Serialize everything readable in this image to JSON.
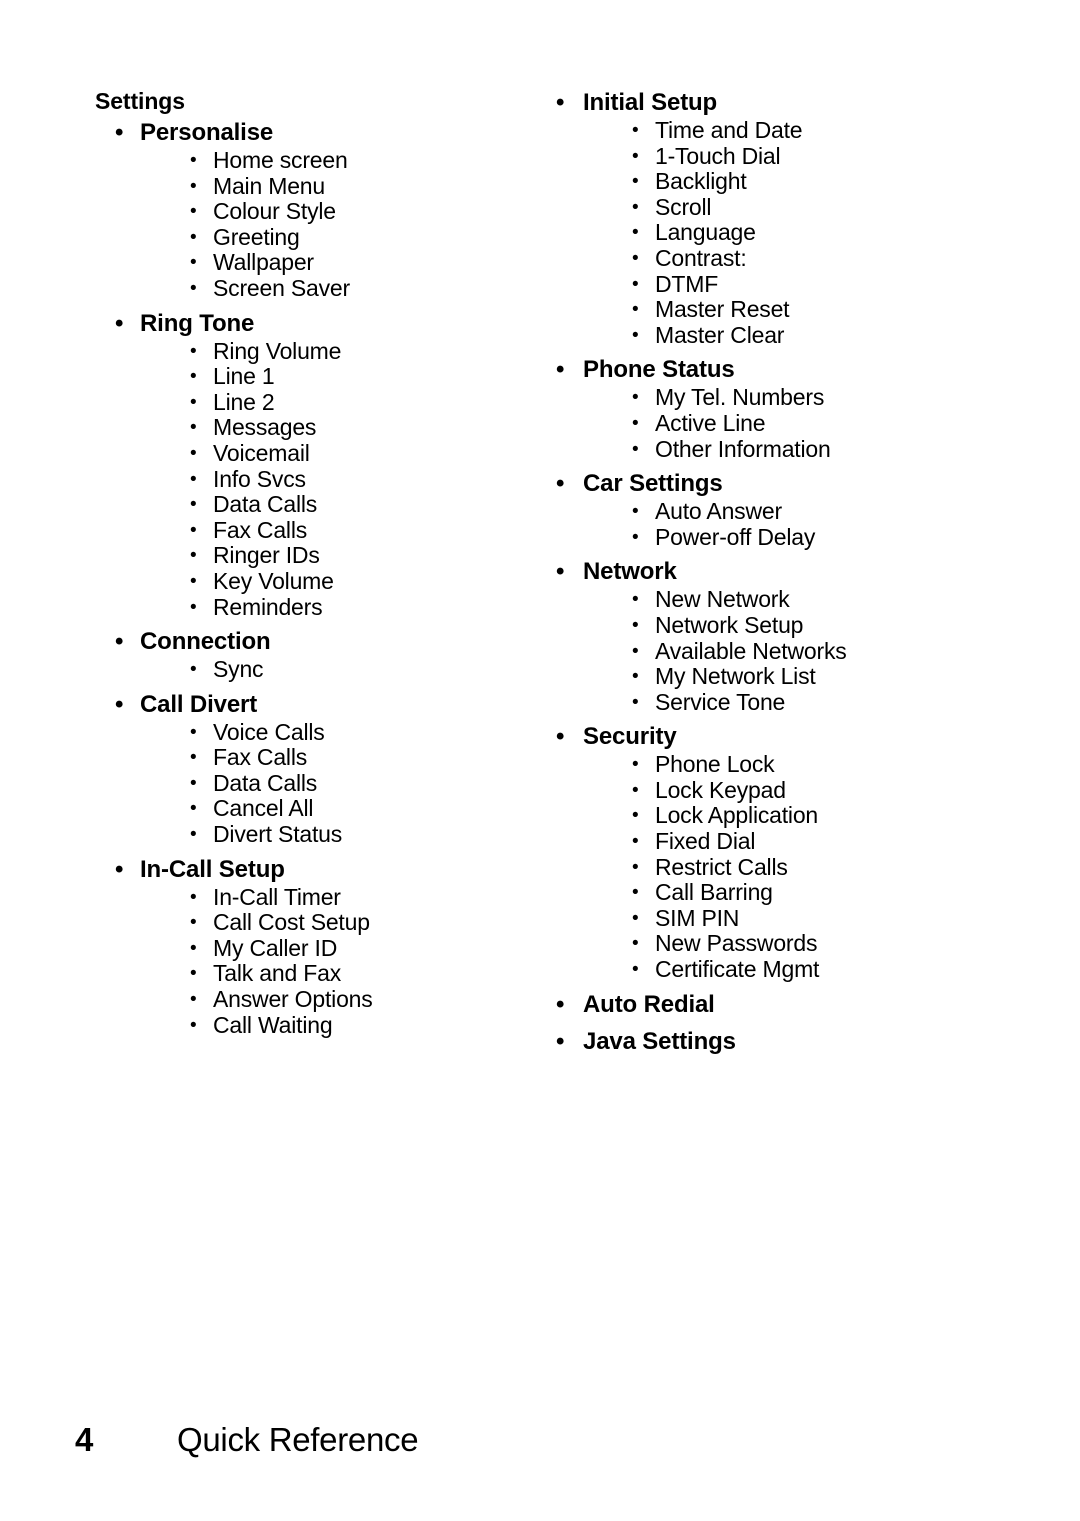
{
  "document": {
    "bullet_glyph": "•"
  },
  "left_column": {
    "root_label": "Settings",
    "groups": [
      {
        "heading": "Personalise",
        "items": [
          "Home screen",
          "Main Menu",
          "Colour Style",
          "Greeting",
          "Wallpaper",
          "Screen Saver"
        ]
      },
      {
        "heading": "Ring Tone",
        "items": [
          "Ring Volume",
          "Line 1",
          "Line 2",
          "Messages",
          "Voicemail",
          "Info Svcs",
          "Data Calls",
          "Fax Calls",
          "Ringer IDs",
          "Key Volume",
          "Reminders"
        ]
      },
      {
        "heading": "Connection",
        "items": [
          "Sync"
        ]
      },
      {
        "heading": "Call Divert",
        "items": [
          "Voice Calls",
          "Fax Calls",
          "Data Calls",
          "Cancel All",
          "Divert Status"
        ]
      },
      {
        "heading": "In-Call Setup",
        "items": [
          "In-Call Timer",
          "Call Cost Setup",
          "My Caller ID",
          "Talk and Fax",
          "Answer Options",
          "Call Waiting"
        ]
      }
    ]
  },
  "right_column": {
    "groups": [
      {
        "heading": "Initial Setup",
        "items": [
          "Time and Date",
          "1-Touch Dial",
          "Backlight",
          "Scroll",
          "Language",
          "Contrast:",
          "DTMF",
          "Master Reset",
          "Master Clear"
        ]
      },
      {
        "heading": "Phone Status",
        "items": [
          "My Tel. Numbers",
          "Active Line",
          "Other Information"
        ]
      },
      {
        "heading": "Car Settings",
        "items": [
          "Auto Answer",
          "Power-off Delay"
        ]
      },
      {
        "heading": "Network",
        "items": [
          "New Network",
          "Network Setup",
          "Available Networks",
          "My Network List",
          "Service Tone"
        ]
      },
      {
        "heading": "Security",
        "items": [
          "Phone Lock",
          "Lock Keypad",
          "Lock Application",
          "Fixed Dial",
          "Restrict Calls",
          "Call Barring",
          "SIM PIN",
          "New Passwords",
          "Certificate Mgmt"
        ]
      },
      {
        "heading": "Auto Redial",
        "items": []
      },
      {
        "heading": "Java Settings",
        "items": []
      }
    ]
  },
  "footer": {
    "page_number": "4",
    "title": "Quick Reference"
  }
}
